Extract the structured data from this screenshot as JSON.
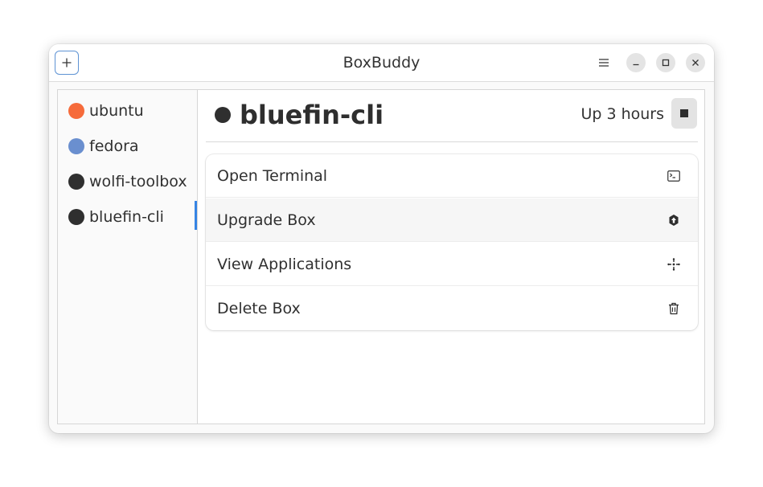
{
  "window": {
    "title": "BoxBuddy"
  },
  "sidebar": {
    "items": [
      {
        "label": "ubuntu",
        "color": "#f66b3b",
        "selected": false
      },
      {
        "label": "fedora",
        "color": "#6a8fcf",
        "selected": false
      },
      {
        "label": "wolfi-toolbox",
        "color": "#2f2f2f",
        "selected": false
      },
      {
        "label": "bluefin-cli",
        "color": "#2f2f2f",
        "selected": true
      }
    ]
  },
  "box": {
    "name": "bluefin-cli",
    "status": "Up 3 hours",
    "dot_color": "#2f2f2f"
  },
  "actions": [
    {
      "label": "Open Terminal",
      "icon": "terminal-icon"
    },
    {
      "label": "Upgrade Box",
      "icon": "upgrade-icon"
    },
    {
      "label": "View Applications",
      "icon": "applications-icon"
    },
    {
      "label": "Delete Box",
      "icon": "trash-icon"
    }
  ],
  "colors": {
    "accent": "#3584e4",
    "add_button_border": "#5e93d4"
  }
}
